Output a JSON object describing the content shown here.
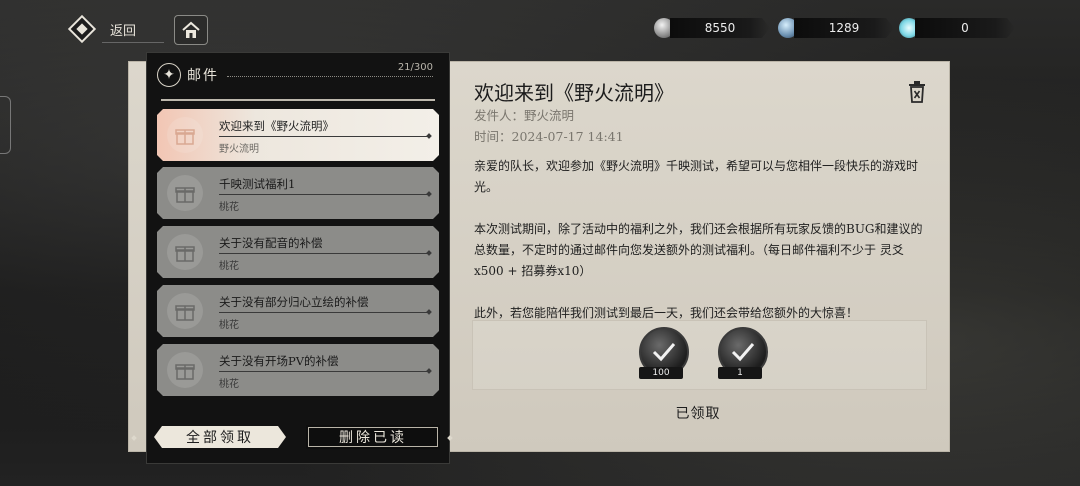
{
  "topbar": {
    "back_label": "返回",
    "currencies": [
      {
        "icon": "silver-coin-icon",
        "value": "8550"
      },
      {
        "icon": "blue-crystal-icon",
        "value": "1289"
      },
      {
        "icon": "cyan-gem-icon",
        "value": "0"
      }
    ]
  },
  "mail_list": {
    "title": "邮件",
    "count": "21/300",
    "items": [
      {
        "title": "欢迎来到《野火流明》",
        "sender": "野火流明",
        "selected": true
      },
      {
        "title": "千映测试福利1",
        "sender": "桃花",
        "selected": false
      },
      {
        "title": "关于没有配音的补偿",
        "sender": "桃花",
        "selected": false
      },
      {
        "title": "关于没有部分归心立绘的补偿",
        "sender": "桃花",
        "selected": false
      },
      {
        "title": "关于没有开场PV的补偿",
        "sender": "桃花",
        "selected": false
      }
    ],
    "claim_all_label": "全部领取",
    "delete_read_label": "删除已读"
  },
  "detail": {
    "title": "欢迎来到《野火流明》",
    "sender_line": "发件人：野火流明",
    "time_line": "时间：2024-07-17    14:41",
    "paragraphs": [
      "亲爱的队长，欢迎参加《野火流明》千映测试，希望可以与您相伴一段快乐的游戏时光。",
      "本次测试期间，除了活动中的福利之外，我们还会根据所有玩家反馈的BUG和建议的总数量，不定时的通过邮件向您发送额外的测试福利。（每日邮件福利不少于 灵爻x500 + 招募券x10）",
      "此外，若您能陪伴我们测试到最后一天，我们还会带给您额外的大惊喜！"
    ],
    "rewards": [
      {
        "qty": "100",
        "icon": "claimed-check-icon"
      },
      {
        "qty": "1",
        "icon": "claimed-check-icon"
      }
    ],
    "status_label": "已领取"
  },
  "colors": {
    "paper": "#e6e1d6",
    "panel": "#121212",
    "selected": "#f3efe8"
  }
}
